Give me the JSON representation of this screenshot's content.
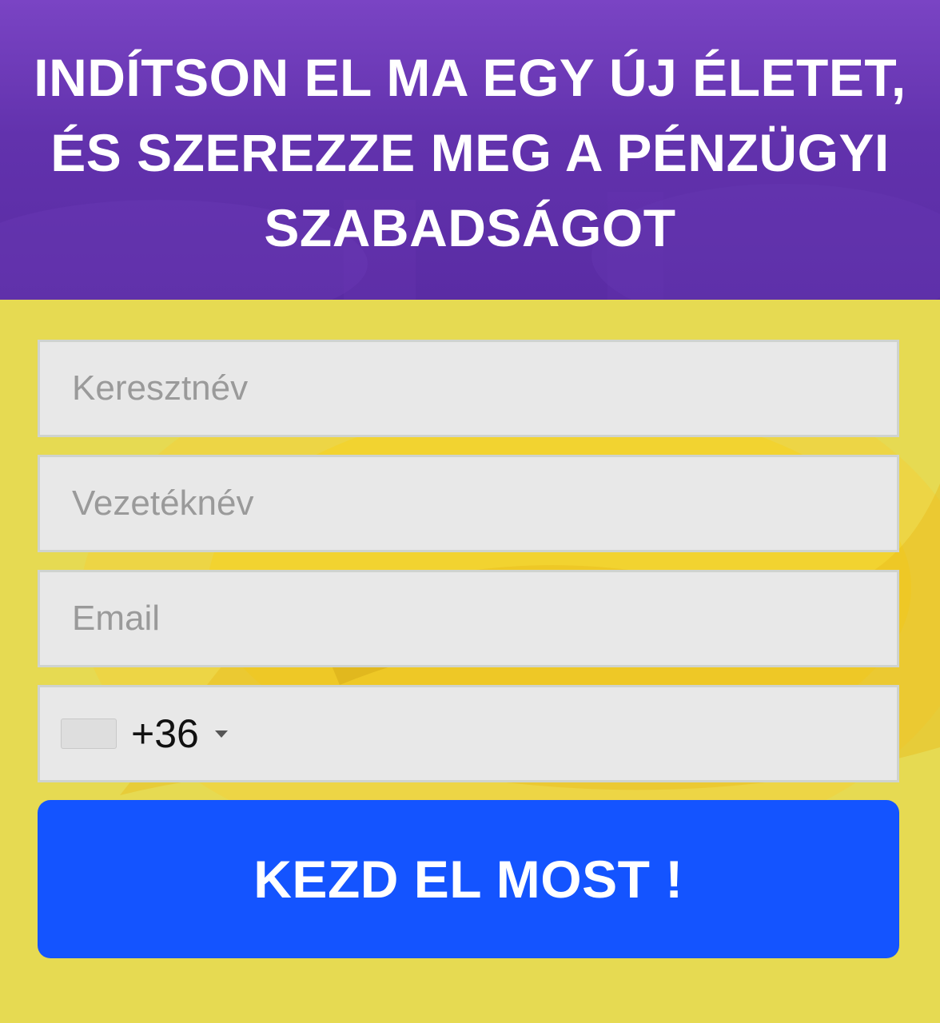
{
  "header": {
    "headline": "INDÍTSON EL MA EGY ÚJ ÉLETET, ÉS SZEREZZE MEG A PÉNZÜGYI SZABADSÁGOT"
  },
  "form": {
    "first_name": {
      "placeholder": "Keresztnév",
      "value": ""
    },
    "last_name": {
      "placeholder": "Vezetéknév",
      "value": ""
    },
    "email": {
      "placeholder": "Email",
      "value": ""
    },
    "phone": {
      "dial_code": "+36",
      "flag_icon": "flag-placeholder-icon",
      "dropdown_icon": "caret-down-icon",
      "value": ""
    },
    "submit_label": "KEZD EL MOST !"
  },
  "colors": {
    "header_purple": "#6232ad",
    "page_yellow": "#e6da52",
    "field_gray": "#e8e8e8",
    "button_blue": "#1454ff",
    "text_white": "#ffffff"
  }
}
